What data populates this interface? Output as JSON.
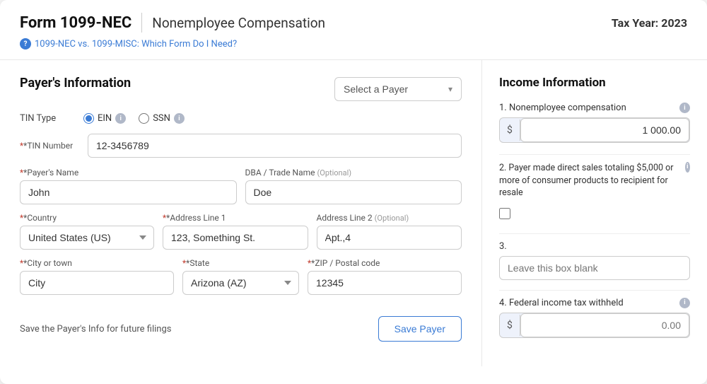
{
  "header": {
    "form_title": "Form 1099-NEC",
    "form_subtitle": "Nonemployee Compensation",
    "tax_year_label": "Tax Year:",
    "tax_year_value": "2023",
    "help_link_text": "1099-NEC vs. 1099-MISC: Which Form Do I Need?",
    "help_icon": "?"
  },
  "payer_section": {
    "section_title": "Payer's Information",
    "select_payer_placeholder": "Select a Payer",
    "tin_type_label": "TIN Type",
    "ein_label": "EIN",
    "ssn_label": "SSN",
    "tin_number_label": "*TIN Number",
    "tin_number_value": "12-3456789",
    "payer_name_label": "*Payer's Name",
    "payer_name_value": "John",
    "dba_label": "DBA / Trade Name",
    "dba_optional": "(Optional)",
    "dba_value": "Doe",
    "country_label": "*Country",
    "country_value": "United States (US)",
    "address1_label": "*Address Line 1",
    "address1_value": "123, Something St.",
    "address2_label": "Address Line 2",
    "address2_optional": "(Optional)",
    "address2_value": "Apt.,4",
    "city_label": "*City or town",
    "city_value": "City",
    "state_label": "*State",
    "state_value": "Arizona (AZ)",
    "zip_label": "*ZIP / Postal code",
    "zip_value": "12345",
    "save_info_text": "Save the Payer's Info for future filings",
    "save_payer_btn": "Save Payer"
  },
  "income_section": {
    "section_title": "Income Information",
    "item1_label": "1. Nonemployee compensation",
    "item1_prefix": "$",
    "item1_value": "1 000.00",
    "item2_label": "2. Payer made direct sales totaling $5,000 or more of consumer products to recipient for resale",
    "item3_label": "3.",
    "item3_placeholder": "Leave this box blank",
    "item4_label": "4. Federal income tax withheld",
    "item4_prefix": "$",
    "item4_value": "0.00"
  },
  "icons": {
    "chevron_down": "▾",
    "help": "?",
    "info": "i"
  }
}
